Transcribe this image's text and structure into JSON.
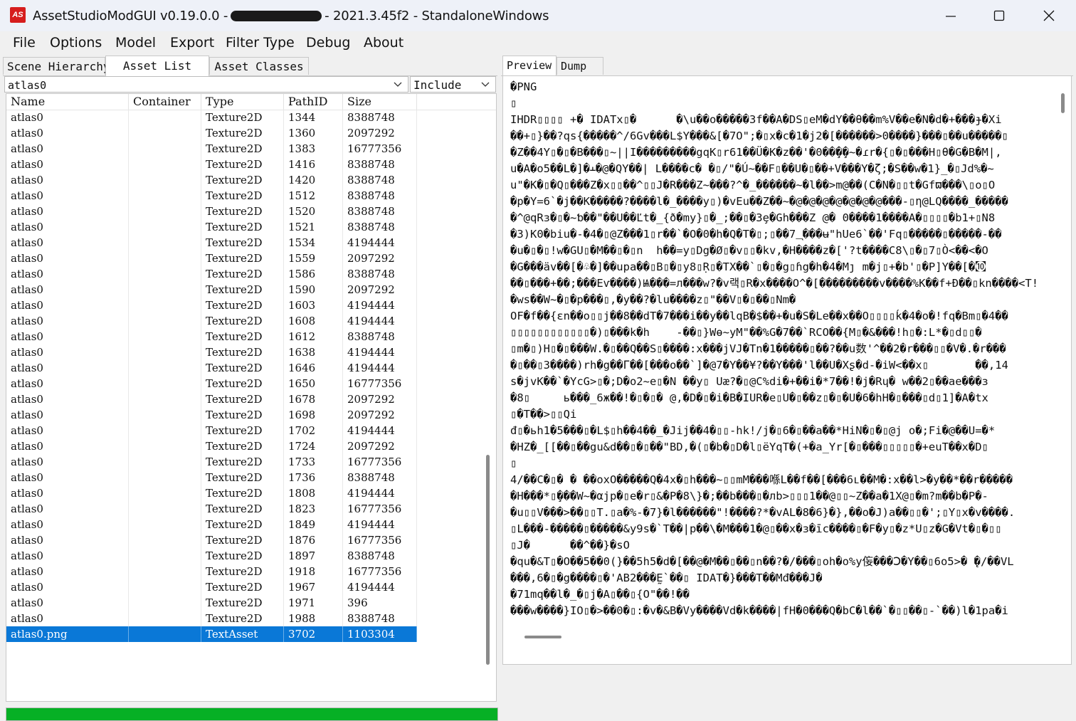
{
  "window": {
    "title_prefix": "AssetStudioModGUI v0.19.0.0 -",
    "title_suffix": "- 2021.3.45f2 - StandaloneWindows",
    "icon_text": "AS"
  },
  "menu": [
    "File",
    "Options",
    "Model",
    "Export",
    "Filter Type",
    "Debug",
    "About"
  ],
  "left_tabs": [
    "Scene Hierarchy",
    "Asset List",
    "Asset Classes"
  ],
  "filter": {
    "value": "atlas0",
    "include_value": "Include"
  },
  "columns": [
    "Name",
    "Container",
    "Type",
    "PathID",
    "Size"
  ],
  "rows": [
    {
      "name": "atlas0",
      "container": "",
      "type": "Texture2D",
      "path": "1344",
      "size": "8388748"
    },
    {
      "name": "atlas0",
      "container": "",
      "type": "Texture2D",
      "path": "1360",
      "size": "2097292"
    },
    {
      "name": "atlas0",
      "container": "",
      "type": "Texture2D",
      "path": "1383",
      "size": "16777356"
    },
    {
      "name": "atlas0",
      "container": "",
      "type": "Texture2D",
      "path": "1416",
      "size": "8388748"
    },
    {
      "name": "atlas0",
      "container": "",
      "type": "Texture2D",
      "path": "1420",
      "size": "8388748"
    },
    {
      "name": "atlas0",
      "container": "",
      "type": "Texture2D",
      "path": "1512",
      "size": "8388748"
    },
    {
      "name": "atlas0",
      "container": "",
      "type": "Texture2D",
      "path": "1520",
      "size": "8388748"
    },
    {
      "name": "atlas0",
      "container": "",
      "type": "Texture2D",
      "path": "1521",
      "size": "8388748"
    },
    {
      "name": "atlas0",
      "container": "",
      "type": "Texture2D",
      "path": "1534",
      "size": "4194444"
    },
    {
      "name": "atlas0",
      "container": "",
      "type": "Texture2D",
      "path": "1559",
      "size": "2097292"
    },
    {
      "name": "atlas0",
      "container": "",
      "type": "Texture2D",
      "path": "1586",
      "size": "8388748"
    },
    {
      "name": "atlas0",
      "container": "",
      "type": "Texture2D",
      "path": "1590",
      "size": "2097292"
    },
    {
      "name": "atlas0",
      "container": "",
      "type": "Texture2D",
      "path": "1603",
      "size": "4194444"
    },
    {
      "name": "atlas0",
      "container": "",
      "type": "Texture2D",
      "path": "1608",
      "size": "4194444"
    },
    {
      "name": "atlas0",
      "container": "",
      "type": "Texture2D",
      "path": "1612",
      "size": "8388748"
    },
    {
      "name": "atlas0",
      "container": "",
      "type": "Texture2D",
      "path": "1638",
      "size": "4194444"
    },
    {
      "name": "atlas0",
      "container": "",
      "type": "Texture2D",
      "path": "1646",
      "size": "4194444"
    },
    {
      "name": "atlas0",
      "container": "",
      "type": "Texture2D",
      "path": "1650",
      "size": "16777356"
    },
    {
      "name": "atlas0",
      "container": "",
      "type": "Texture2D",
      "path": "1678",
      "size": "2097292"
    },
    {
      "name": "atlas0",
      "container": "",
      "type": "Texture2D",
      "path": "1698",
      "size": "2097292"
    },
    {
      "name": "atlas0",
      "container": "",
      "type": "Texture2D",
      "path": "1702",
      "size": "4194444"
    },
    {
      "name": "atlas0",
      "container": "",
      "type": "Texture2D",
      "path": "1724",
      "size": "2097292"
    },
    {
      "name": "atlas0",
      "container": "",
      "type": "Texture2D",
      "path": "1733",
      "size": "16777356"
    },
    {
      "name": "atlas0",
      "container": "",
      "type": "Texture2D",
      "path": "1736",
      "size": "8388748"
    },
    {
      "name": "atlas0",
      "container": "",
      "type": "Texture2D",
      "path": "1808",
      "size": "4194444"
    },
    {
      "name": "atlas0",
      "container": "",
      "type": "Texture2D",
      "path": "1823",
      "size": "16777356"
    },
    {
      "name": "atlas0",
      "container": "",
      "type": "Texture2D",
      "path": "1849",
      "size": "4194444"
    },
    {
      "name": "atlas0",
      "container": "",
      "type": "Texture2D",
      "path": "1876",
      "size": "16777356"
    },
    {
      "name": "atlas0",
      "container": "",
      "type": "Texture2D",
      "path": "1897",
      "size": "8388748"
    },
    {
      "name": "atlas0",
      "container": "",
      "type": "Texture2D",
      "path": "1918",
      "size": "16777356"
    },
    {
      "name": "atlas0",
      "container": "",
      "type": "Texture2D",
      "path": "1967",
      "size": "4194444"
    },
    {
      "name": "atlas0",
      "container": "",
      "type": "Texture2D",
      "path": "1971",
      "size": "396"
    },
    {
      "name": "atlas0",
      "container": "",
      "type": "Texture2D",
      "path": "1988",
      "size": "8388748"
    },
    {
      "name": "atlas0.png",
      "container": "",
      "type": "TextAsset",
      "path": "3702",
      "size": "1103304",
      "selected": true
    }
  ],
  "right_tabs": [
    "Preview",
    "Dump"
  ],
  "preview_lines": [
    "�PNG",
    "▯",
    "IHDR▯▯▯▯ +� IDATx▯�      �\\u��o�����3f��A�DS▯eM�dY��θ��m%V��e�N�d�+���ɟ�Xi",
    "��+▯}��?qs{�����^/6Gv���L$Y���&[�7O\";�▯x�c�1�j2�[������>0����}���▯��u�����▯",
    "�Z��4Y▯�▯�B���▯~||I���������gqK▯r61��Ü�K�z��'�0��̧�̧�~�ɾr�{▯�▯���H▯θ�G�B�M|,",
    "u�A�o5��L�]�ⲳ�@�QY��| L����c� �▯/\"�Ú~��F▯��U�▯��+V���Y�ζ;�S��w�1}_�▯Jd%�~",
    "u\"�K�▯�Q▯���Z�x▯▯��^▯▯J�R���Z~���?^�_������~�l��>m@��(C�N�▯▯t�Gfϖ���\\▯o▯O",
    "�p�Y=6`�j��K�����?����l�_����y▯)�vEu��Z��~�@�@�@�@�@�@�@���-▯η@LQ����_�����",
    "�^@qRз�▯�~ƅ��\"��U��Ľt�_{ð�my}▯�_;��▯�3ȩ�Gh���Z @� 0����1����A�▯▯▯▯�b1+▯N8",
    "�3)K0�biu�-�4�▯@Z���1▯r��`�O�0�h�Q�T�▯;▯��7_ͅ���ʉ\"hUe6`��'Fq▯�����▯�����-��",
    "�u�▯�▯!w�GU▯�M��▯�▯n  h��=y▯Dg�Ø▯�v▯▯�kv,�H����z�['?t����C8\\▯�▯7▯Ò<��<�O",
    "�G���äv��[�♧�]��upa��▯B▯�▯y8▯Ṛ▯�TX��`▯�▯�g▯ɦg�h�4�Mȷ m�j▯+�b'▯�P]Y��[�㉈",
    "��▯���+��;���Eѵ����)Ѩ���=л���w?�v랙▯R�x����O^�[���������v����%K��f+Đ��▯kn����<T!",
    "�ws��W~�▯�p���▯,�y��?�lu����z▯\"��V▯�▯��▯Nm�",
    "OF�f��{ɛn��o▯▯j��8��dT�7���i��y��lqB�$��+�u�S�Le��x��O▯▯▯▯ḱ�4�o�!fq�Bm▯�4��",
    "▯▯▯▯▯▯▯▯▯▯▯▯�)▯���k�h    -��▯}Wɵ~yM\"��%G�7��`RCO��{M▯�&���!h▯�:L*�▯d▯▯�",
    "▯m�▯)H▯�▯���W.�▯��Q��S▯����:x���jVJ�Tn�1�����▯��?��u数'^��2�r���▯▯�V�.�r���",
    "�▯��▯3����)rh�g��Γ��[���o��`]�@7�Y��¥?��Y���'l��U�Xʂ�d-�iW<��x▯       ��,14",
    "s�jvK��`�YcG>▯�;D�o2~e▯�N ��y▯ Uæ?�▯@C%di�+��i�*7��!�j�Rɥ� w��2▯��ae���з",
    "�8▯     ь���_6ж��!�▯�▯� @,�D�▯�i�B�IUR�e▯U�▯��z▯�▯�U�6�hH�▯���▯d▯1]�A�tx",
    "▯�T��>▯▯Qi",
    "đ▯�ьh1�5���▯�L$▯h��4��_�Jij��4�▯▯-hk!/j�▯6�▯��a��*HiN�▯�▯@j o�;Fi�@��U=�*",
    "�HZ�_[[��▯��gu&d��▯�▯��\"BD,�(▯�b�▯D�l▯ëYqT�(+�a_Yr[�▯���▯▯▯▯▯�+euT��x�D▯",
    "▯",
    "4/��C�▯� � ��oxO�����Q�4x�▯h���~▯▯mM���喺L��f��[���6ւ��M�:x��l>�y��*��r�����",
    "�H���*▯̧���W~�αjp�▯e�r▯&�P�8\\}�;��b���▯�лb>▯▯▯1��@▯▯~Z��a�1X@▯�m?m��b�P�-",
    "�u▯▯V���>��▯▯T.▯a�%-�7}�l������\"!����?*�vAL�8�6}�},��o�J)a��▯▯�';▯Y▯x�v����.",
    "▯L���-�����▯�����&y9s�`T��|p��\\�M���1�@▯��x�з�īc����▯�F�y▯�z*U▯z�G�Vt�▯�▯▯",
    "▯J�      ��^��}�sO",
    "�qu�&T▯�O��5��0(}��5h5�d�[��@�M��▯��▯n��?�/���▯oh�o%y侫���Ↄ�Y��▯6o5>� ̨�/��VL",
    "���,6�▯�g����▯�'AB2���Ḛ`��▯ IDAT�}���T��Mđ���J�",
    "�71mq��l�_�▯j�A▯��▯{O\"��!��",
    "���w����}IO▯�>��0�▯:�v�&B�Vy����Vd�k����|fH�0���Q�bC�l��`�▯▯��▯-`��)l�1pa�i"
  ],
  "progress": {
    "percent": 100
  }
}
